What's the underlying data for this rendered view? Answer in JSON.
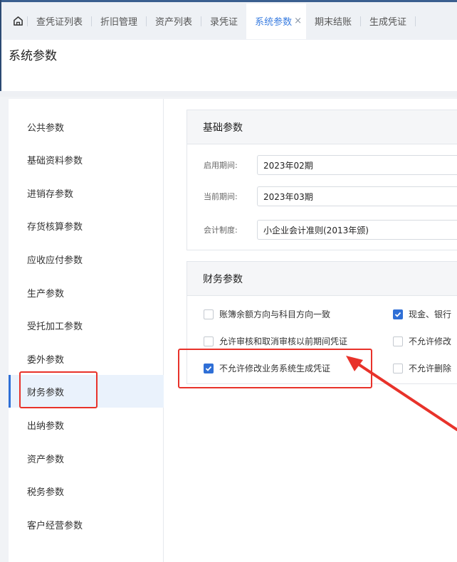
{
  "tabs": [
    {
      "label": "查凭证列表"
    },
    {
      "label": "折旧管理"
    },
    {
      "label": "资产列表"
    },
    {
      "label": "录凭证"
    },
    {
      "label": "系统参数",
      "close": "×"
    },
    {
      "label": "期末结账"
    },
    {
      "label": "生成凭证"
    }
  ],
  "page_title": "系统参数",
  "sidebar": {
    "items": [
      {
        "label": "公共参数"
      },
      {
        "label": "基础资料参数"
      },
      {
        "label": "进销存参数"
      },
      {
        "label": "存货核算参数"
      },
      {
        "label": "应收应付参数"
      },
      {
        "label": "生产参数"
      },
      {
        "label": "受托加工参数"
      },
      {
        "label": "委外参数"
      },
      {
        "label": "财务参数"
      },
      {
        "label": "出纳参数"
      },
      {
        "label": "资产参数"
      },
      {
        "label": "税务参数"
      },
      {
        "label": "客户经营参数"
      }
    ],
    "active_index": 8
  },
  "basic_section": {
    "title": "基础参数",
    "fields": [
      {
        "label": "启用期间:",
        "value": "2023年02期"
      },
      {
        "label": "当前期间:",
        "value": "2023年03期"
      },
      {
        "label": "会计制度:",
        "value": "小企业会计准则(2013年颁)"
      }
    ]
  },
  "finance_section": {
    "title": "财务参数",
    "options": [
      {
        "label": "账簿余额方向与科目方向一致",
        "checked": false
      },
      {
        "label": "现金、银行",
        "checked": true
      },
      {
        "label": "允许审核和取消审核以前期间凭证",
        "checked": false
      },
      {
        "label": "不允许修改",
        "checked": false
      },
      {
        "label": "不允许修改业务系统生成凭证",
        "checked": true
      },
      {
        "label": "不允许删除",
        "checked": false
      }
    ]
  },
  "colors": {
    "accent": "#2f6fd6",
    "highlight": "#e8322a"
  }
}
